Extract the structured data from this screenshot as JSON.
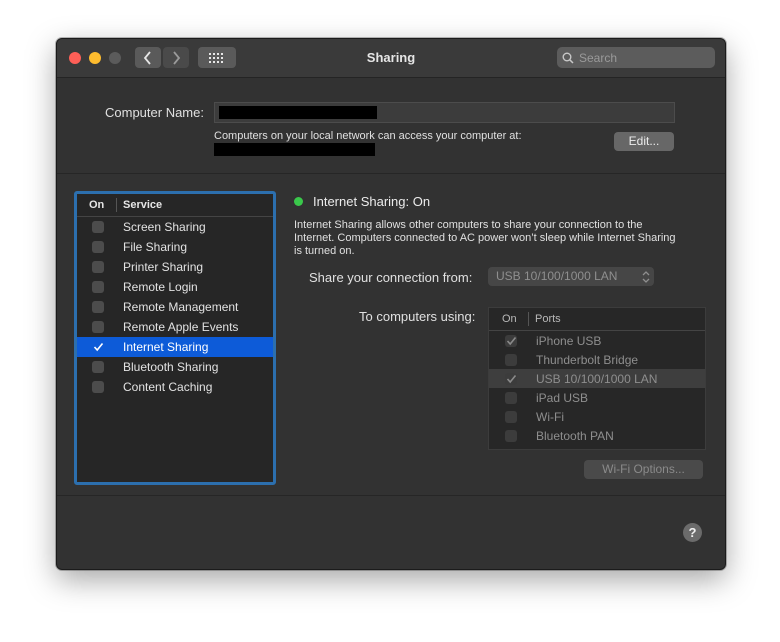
{
  "window": {
    "title": "Sharing",
    "search_placeholder": "Search",
    "icons": {
      "back": "chevron-left-icon",
      "forward": "chevron-right-icon",
      "grid": "grid-icon",
      "search": "search-icon",
      "help": "question-icon"
    }
  },
  "computer_name": {
    "label": "Computer Name:",
    "access_text": "Computers on your local network can access your computer at:",
    "edit_label": "Edit..."
  },
  "services": {
    "header_on": "On",
    "header_service": "Service",
    "items": [
      {
        "label": "Screen Sharing",
        "checked": false,
        "selected": false
      },
      {
        "label": "File Sharing",
        "checked": false,
        "selected": false
      },
      {
        "label": "Printer Sharing",
        "checked": false,
        "selected": false
      },
      {
        "label": "Remote Login",
        "checked": false,
        "selected": false
      },
      {
        "label": "Remote Management",
        "checked": false,
        "selected": false
      },
      {
        "label": "Remote Apple Events",
        "checked": false,
        "selected": false
      },
      {
        "label": "Internet Sharing",
        "checked": true,
        "selected": true
      },
      {
        "label": "Bluetooth Sharing",
        "checked": false,
        "selected": false
      },
      {
        "label": "Content Caching",
        "checked": false,
        "selected": false
      }
    ]
  },
  "detail": {
    "status": "Internet Sharing: On",
    "status_color": "#3ac84b",
    "description": "Internet Sharing allows other computers to share your connection to the Internet. Computers connected to AC power won’t sleep while Internet Sharing is turned on.",
    "share_from_label": "Share your connection from:",
    "share_from_value": "USB 10/100/1000 LAN",
    "to_computers_label": "To computers using:",
    "ports_header_on": "On",
    "ports_header_ports": "Ports",
    "ports": [
      {
        "label": "iPhone USB",
        "checked": true
      },
      {
        "label": "Thunderbolt Bridge",
        "checked": false
      },
      {
        "label": "USB 10/100/1000 LAN",
        "checked": true
      },
      {
        "label": "iPad USB",
        "checked": false
      },
      {
        "label": "Wi-Fi",
        "checked": false
      },
      {
        "label": "Bluetooth PAN",
        "checked": false
      }
    ],
    "wifi_options_label": "Wi-Fi Options...",
    "help_label": "?"
  },
  "colors": {
    "accent": "#0d5bd8",
    "focus_ring": "#2c6fae"
  }
}
